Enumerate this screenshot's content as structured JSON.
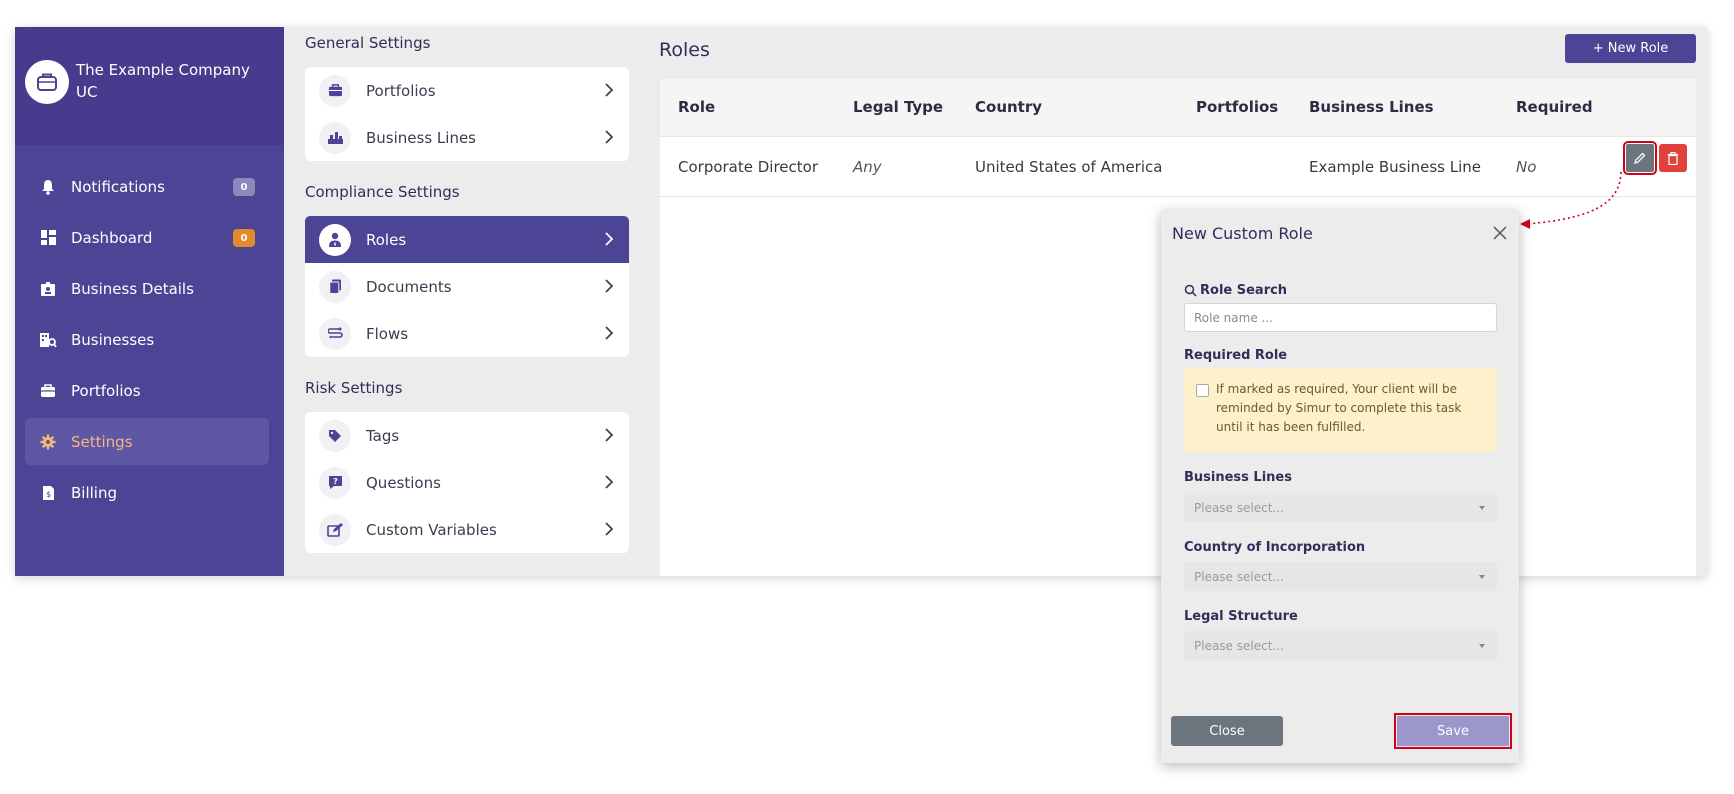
{
  "brand": {
    "name": "The Example Company UC"
  },
  "sidebar": {
    "items": [
      {
        "label": "Notifications",
        "icon": "bell-icon",
        "badge": "0"
      },
      {
        "label": "Dashboard",
        "icon": "dashboard-icon",
        "badge": "0"
      },
      {
        "label": "Business Details",
        "icon": "id-card-icon"
      },
      {
        "label": "Businesses",
        "icon": "building-search-icon"
      },
      {
        "label": "Portfolios",
        "icon": "briefcase-icon"
      },
      {
        "label": "Settings",
        "icon": "gear-icon",
        "active": true
      },
      {
        "label": "Billing",
        "icon": "invoice-icon"
      }
    ]
  },
  "settings": {
    "general_title": "General Settings",
    "general_items": [
      {
        "label": "Portfolios",
        "icon": "briefcase-icon"
      },
      {
        "label": "Business Lines",
        "icon": "business-lines-icon"
      }
    ],
    "compliance_title": "Compliance Settings",
    "compliance_items": [
      {
        "label": "Roles",
        "icon": "user-role-icon",
        "active": true
      },
      {
        "label": "Documents",
        "icon": "documents-icon"
      },
      {
        "label": "Flows",
        "icon": "flows-icon"
      }
    ],
    "risk_title": "Risk Settings",
    "risk_items": [
      {
        "label": "Tags",
        "icon": "tag-icon"
      },
      {
        "label": "Questions",
        "icon": "question-icon"
      },
      {
        "label": "Custom Variables",
        "icon": "edit-variable-icon"
      }
    ]
  },
  "main": {
    "title": "Roles",
    "new_role_button": "+ New Role",
    "table": {
      "headers": [
        "Role",
        "Legal Type",
        "Country",
        "Portfolios",
        "Business Lines",
        "Required"
      ],
      "rows": [
        [
          "Corporate Director",
          "Any",
          "United States of America",
          "",
          "Example Business Line",
          "No"
        ]
      ]
    }
  },
  "modal": {
    "title": "New Custom Role",
    "role_search_label": "Role Search",
    "role_search_placeholder": "Role name ...",
    "required_role_label": "Required Role",
    "required_notice": "If marked as required, Your client will be reminded by Simur to complete this task until it has been fulfilled.",
    "business_lines_label": "Business Lines",
    "business_lines_value": "Please select...",
    "country_label": "Country of Incorporation",
    "country_value": "Please select...",
    "legal_structure_label": "Legal Structure",
    "legal_structure_value": "Please select...",
    "close_button": "Close",
    "save_button": "Save"
  },
  "colors": {
    "brand_purple": "#4c4495",
    "accent_orange": "#f3b87a",
    "highlight_red": "#d0021b",
    "delete_red": "#e2413a"
  }
}
